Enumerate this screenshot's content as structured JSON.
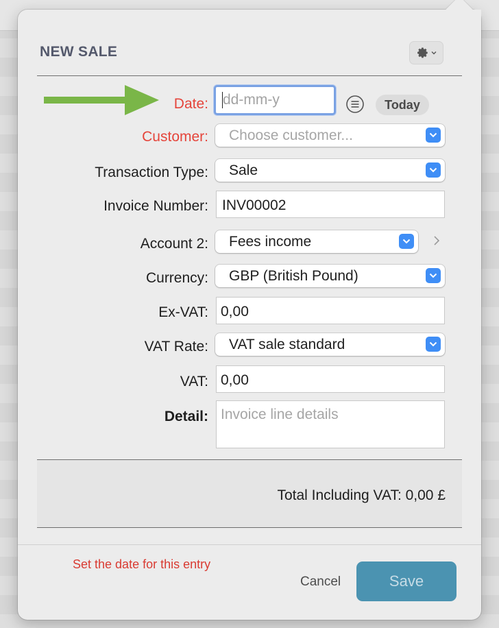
{
  "dialog": {
    "title": "NEW SALE"
  },
  "form": {
    "date": {
      "label": "Date:",
      "placeholder": "dd-mm-y",
      "today_label": "Today"
    },
    "customer": {
      "label": "Customer:",
      "placeholder": "Choose customer..."
    },
    "transaction_type": {
      "label": "Transaction Type:",
      "value": "Sale"
    },
    "invoice_number": {
      "label": "Invoice Number:",
      "value": "INV00002"
    },
    "account": {
      "label": "Account 2:",
      "value": "Fees income"
    },
    "currency": {
      "label": "Currency:",
      "value": "GBP (British Pound)"
    },
    "ex_vat": {
      "label": "Ex-VAT:",
      "value": "0,00"
    },
    "vat_rate": {
      "label": "VAT Rate:",
      "value": "VAT sale standard"
    },
    "vat": {
      "label": "VAT:",
      "value": "0,00"
    },
    "detail": {
      "label": "Detail:",
      "placeholder": "Invoice line details"
    }
  },
  "total": {
    "text": "Total Including VAT: 0,00 £"
  },
  "footer": {
    "hint": "Set the date for this entry",
    "cancel_label": "Cancel",
    "save_label": "Save"
  },
  "colors": {
    "required_label": "#e5453b",
    "accent_blue": "#3f8ef6",
    "save_button": "#4b93b1",
    "guide_arrow": "#7ab648"
  },
  "icons": {
    "gear": "gear-icon",
    "list": "list-icon",
    "chevron": "chevron-down-icon",
    "disclosure": "chevron-right-icon",
    "arrow": "arrow-right-icon"
  }
}
